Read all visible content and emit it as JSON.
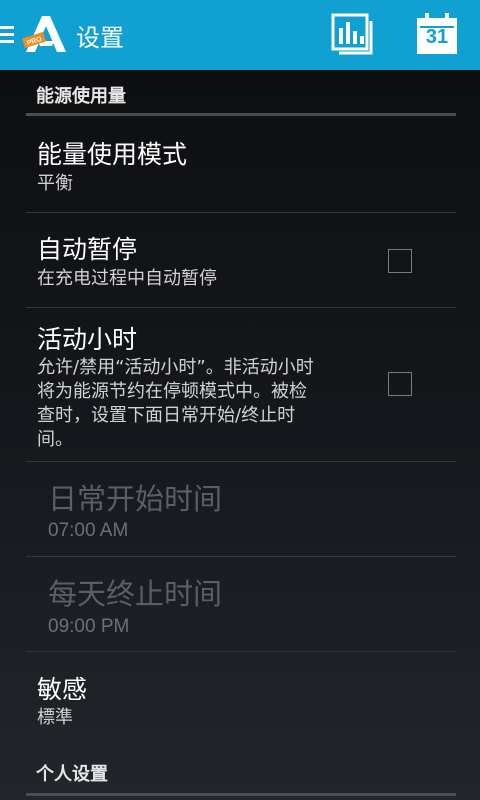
{
  "action_bar": {
    "title": "设置",
    "logo_badge": "PRO",
    "calendar_day": "31",
    "accent_color": "#10a0d2",
    "icons": [
      "menu-icon",
      "app-logo",
      "bar-chart-icon",
      "calendar-icon"
    ]
  },
  "sections": {
    "energy": {
      "header": "能源使用量"
    },
    "personal": {
      "header": "个人设置"
    }
  },
  "prefs": {
    "mode": {
      "title": "能量使用模式",
      "summary": "平衡"
    },
    "auto_pause": {
      "title": "自动暂停",
      "summary": "在充电过程中自动暂停",
      "checked": false
    },
    "active_hours": {
      "title": "活动小时",
      "summary_lines": [
        "允许/禁用“活动小时”。非活动小时",
        "将为能源节约在停顿模式中。被检",
        "查时，设置下面日常开始/终止时",
        "间。"
      ],
      "checked": false
    },
    "start_time": {
      "title": "日常开始时间",
      "summary": "07:00 AM",
      "enabled": false
    },
    "end_time": {
      "title": "每天终止时间",
      "summary": "09:00 PM",
      "enabled": false
    },
    "sensitivity": {
      "title": "敏感",
      "summary": "標準"
    }
  }
}
